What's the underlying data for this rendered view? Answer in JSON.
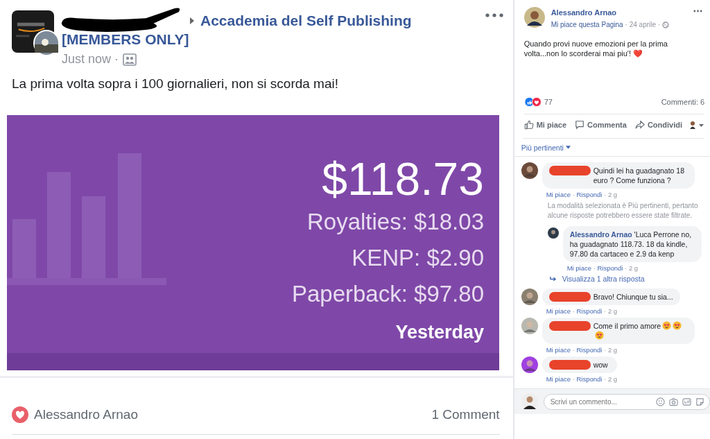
{
  "post": {
    "group": "Accademia del Self Publishing",
    "group_suffix": "[MEMBERS ONLY]",
    "time": "Just now ·",
    "text": "La prima volta sopra i 100 giornalieri, non si scorda mai!",
    "card": {
      "total": "$118.73",
      "lines": [
        "Royalties: $18.03",
        "KENP: $2.90",
        "Paperback: $97.80"
      ],
      "period": "Yesterday"
    },
    "liker": "Alessandro Arnao",
    "comment_count": "1 Comment"
  },
  "side": {
    "author": "Alessandro Arnao",
    "page_like": "Mi piace questa Pagina",
    "date": "· 24 aprile ·",
    "text": "Quando provi nuove emozioni per la prima volta...non lo scorderai mai piu'! ❤️",
    "reaction_count": "77",
    "comments_count": "Commenti: 6",
    "actions": [
      "Mi piace",
      "Commenta",
      "Condividi"
    ],
    "sort": "Più pertinenti",
    "comments": [
      {
        "kind": "comment",
        "redacted": true,
        "text": "Quindi lei ha guadagnato 18 euro ? Come funziona ?",
        "like": "Mi piace",
        "sep": "·",
        "reply": "Rispondi",
        "age": "· 2 g"
      },
      {
        "kind": "note",
        "text": "La modalità selezionata è Più pertinenti, pertanto alcune risposte potrebbero essere state filtrate."
      },
      {
        "kind": "reply",
        "redacted": false,
        "text": "**Alessandro Arnao** 'Luca Perrone no, ha guadagnato 118.73. 18 da kindle, 97.80 da cartaceo e 2.9 da kenp",
        "like": "Mi piace",
        "sep": "·",
        "reply": "Rispondi",
        "age": "· 2 g"
      },
      {
        "kind": "more",
        "text": "Visualizza 1 altra risposta"
      },
      {
        "kind": "comment",
        "redacted": true,
        "text": "Bravo! Chiunque tu sia...",
        "like": "Mi piace",
        "sep": "·",
        "reply": "Rispondi",
        "age": "· 2 g"
      },
      {
        "kind": "comment",
        "redacted": true,
        "text": "Come il primo amore",
        "emojis": [
          {
            "kind": "heart_eyes"
          },
          {
            "kind": "heart_eyes"
          },
          {
            "kind": "heart_eyes"
          }
        ],
        "like": "Mi piace",
        "sep": "·",
        "reply": "Rispondi",
        "age": "· 2 g"
      },
      {
        "kind": "comment",
        "redacted": true,
        "text": "wow",
        "like": "Mi piace",
        "sep": "·",
        "reply": "Rispondi",
        "age": "· 2 g"
      }
    ],
    "composer": {
      "placeholder": "Scrivi un commento..."
    }
  }
}
